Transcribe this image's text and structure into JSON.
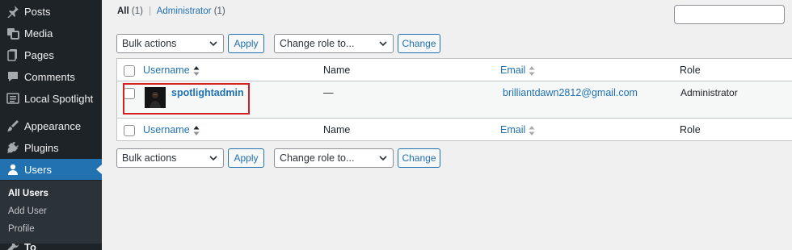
{
  "sidebar": {
    "items": [
      {
        "label": "Posts",
        "icon": "pin-icon"
      },
      {
        "label": "Media",
        "icon": "media-icon"
      },
      {
        "label": "Pages",
        "icon": "pages-icon"
      },
      {
        "label": "Comments",
        "icon": "comments-icon"
      },
      {
        "label": "Local Spotlight",
        "icon": "spotlight-icon"
      },
      {
        "label": "Appearance",
        "icon": "appearance-icon"
      },
      {
        "label": "Plugins",
        "icon": "plugins-icon"
      },
      {
        "label": "Users",
        "icon": "users-icon",
        "active": true
      }
    ],
    "submenu": [
      {
        "label": "All Users",
        "current": true
      },
      {
        "label": "Add User"
      },
      {
        "label": "Profile"
      }
    ],
    "partial_item": "To"
  },
  "filters": {
    "all_label": "All",
    "all_count": "(1)",
    "separator": "|",
    "admin_label": "Administrator",
    "admin_count": "(1)"
  },
  "search": {
    "value": ""
  },
  "actions": {
    "bulk_label": "Bulk actions",
    "apply_label": "Apply",
    "role_label": "Change role to...",
    "change_label": "Change"
  },
  "table": {
    "columns": {
      "username": "Username",
      "name": "Name",
      "email": "Email",
      "role": "Role"
    },
    "rows": [
      {
        "username": "spotlightadmin",
        "name": "—",
        "email": "brilliantdawn2812@gmail.com",
        "role": "Administrator"
      }
    ]
  },
  "colors": {
    "accent": "#2271b1",
    "sidebar": "#1d2327",
    "highlight": "#d42020"
  }
}
